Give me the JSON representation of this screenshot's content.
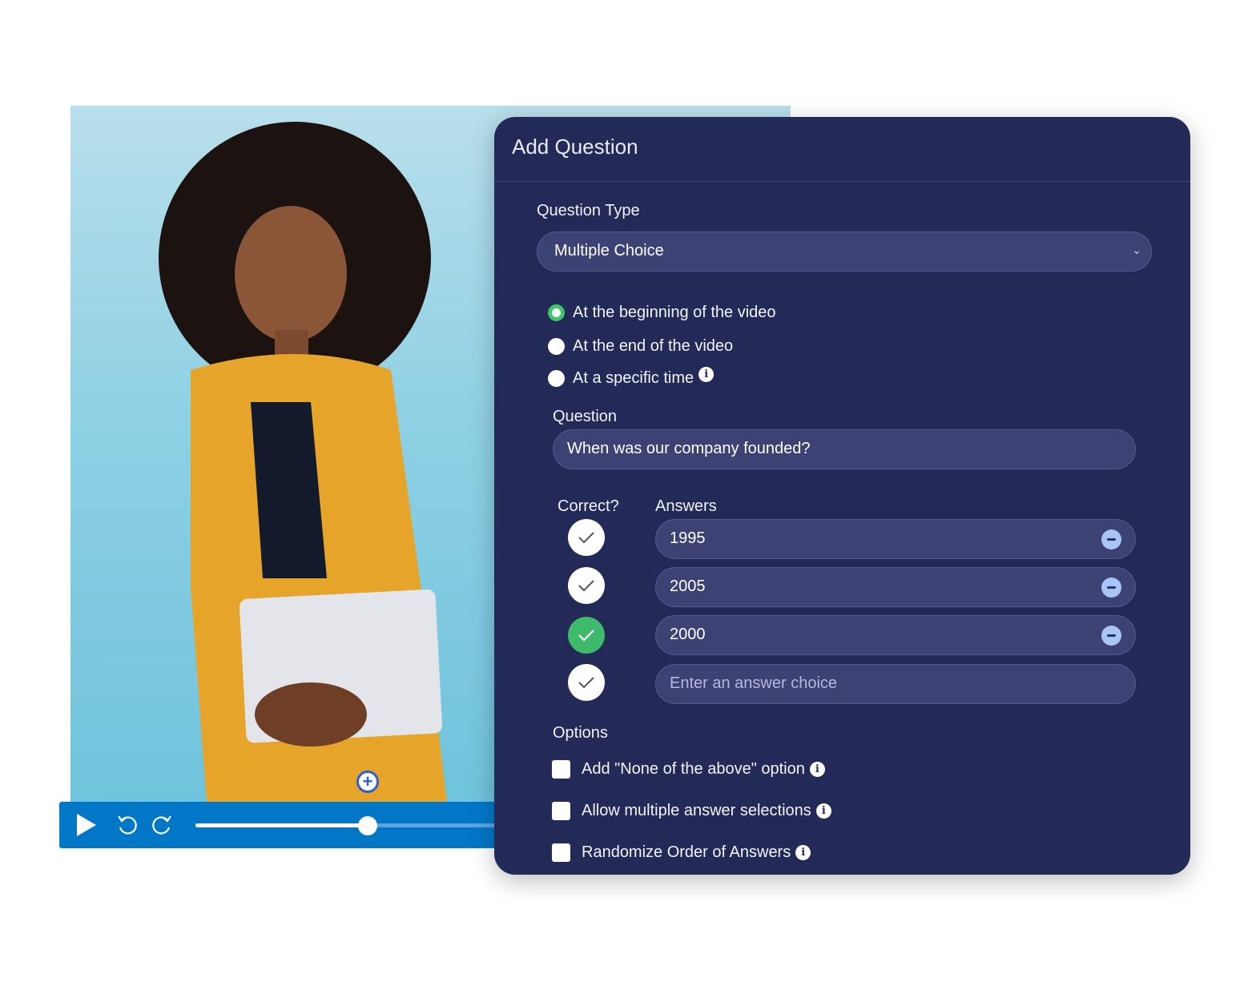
{
  "video": {
    "progress_fraction": 0.55,
    "icons": {
      "play": "play-icon",
      "rewind": "rewind-icon",
      "forward": "forward-icon",
      "add_marker": "plus-circle-icon"
    }
  },
  "panel": {
    "title": "Add Question",
    "question_type_label": "Question Type",
    "question_type_value": "Multiple Choice",
    "timing_options": [
      {
        "label": "At the beginning of the video",
        "selected": true
      },
      {
        "label": "At the end of the video",
        "selected": false
      },
      {
        "label": "At a specific time",
        "selected": false,
        "info": true
      }
    ],
    "question_label": "Question",
    "question_value": "When was our company founded?",
    "correct_label": "Correct?",
    "answers_label": "Answers",
    "answers": [
      {
        "value": "1995",
        "correct": false
      },
      {
        "value": "2005",
        "correct": false
      },
      {
        "value": "2000",
        "correct": true
      }
    ],
    "answer_placeholder": "Enter an  answer choice",
    "options_label": "Options",
    "options": [
      {
        "label": "Add \"None of the above\" option",
        "checked": false
      },
      {
        "label": "Allow multiple answer selections",
        "checked": false
      },
      {
        "label": "Randomize Order of Answers",
        "checked": false
      }
    ],
    "colors": {
      "panel_bg": "#232a58",
      "accent_green": "#3ec66b",
      "player_blue": "#0277c8"
    }
  }
}
